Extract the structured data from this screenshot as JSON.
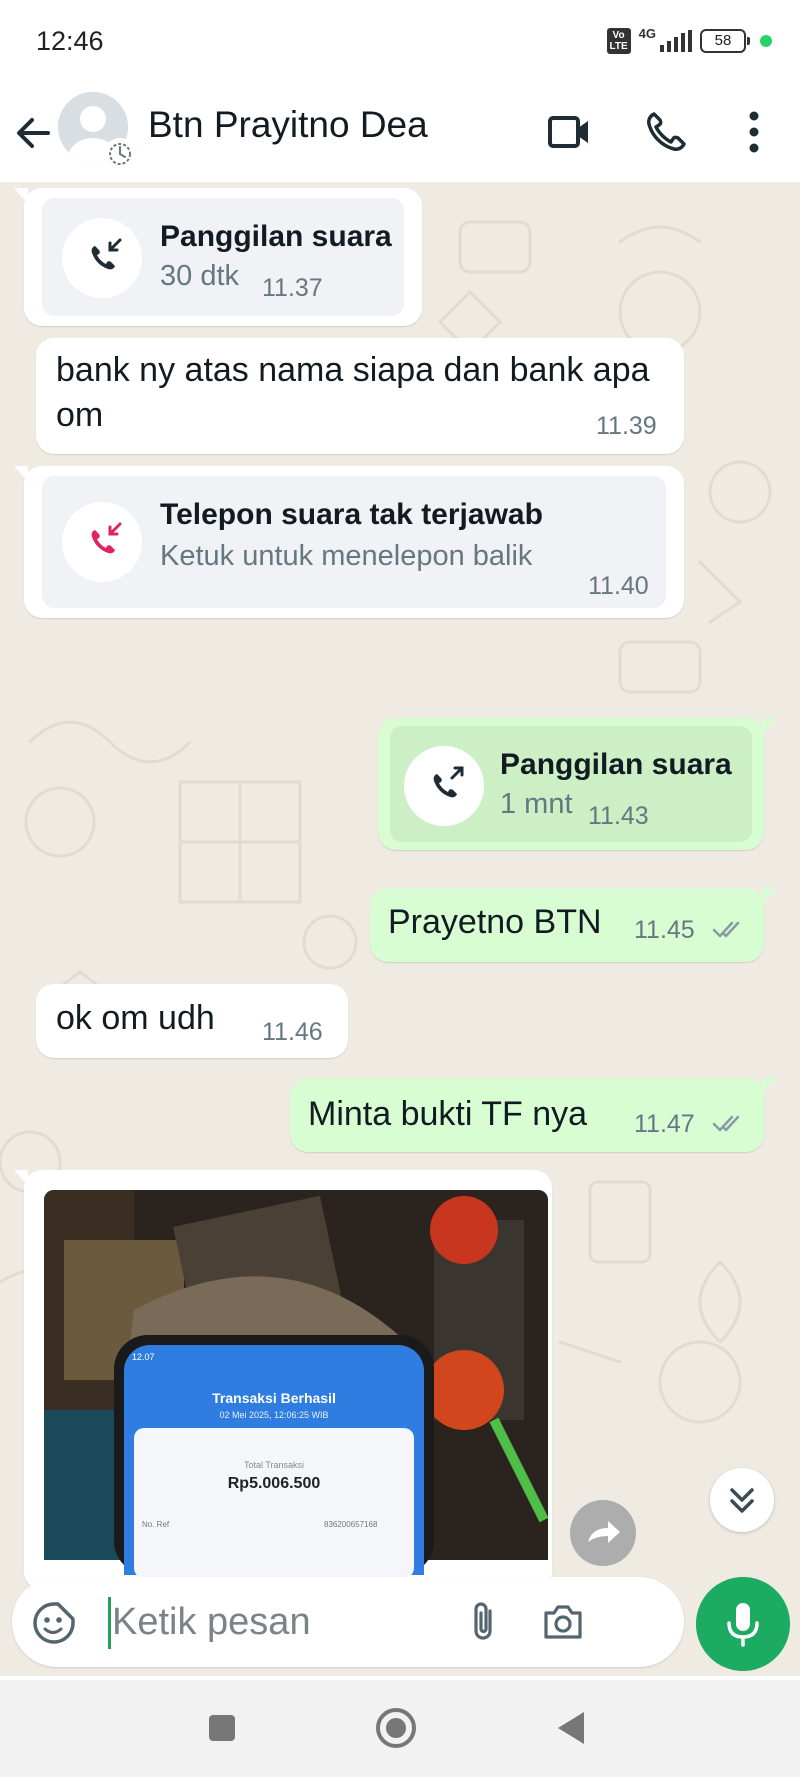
{
  "status": {
    "time": "12:46",
    "volte": "Vo LTE",
    "network": "4G",
    "battery": "58"
  },
  "header": {
    "contact_name": "Btn Prayitno Dea"
  },
  "messages": [
    {
      "kind": "call",
      "direction": "incoming",
      "title": "Panggilan suara",
      "sub": "30 dtk",
      "time": "11.37"
    },
    {
      "kind": "text",
      "direction": "incoming",
      "text": "bank ny atas nama siapa dan bank apa om",
      "time": "11.39"
    },
    {
      "kind": "missed_call",
      "direction": "incoming",
      "title": "Telepon suara tak terjawab",
      "sub": "Ketuk untuk menelepon balik",
      "time": "11.40"
    },
    {
      "kind": "call",
      "direction": "outgoing",
      "title": "Panggilan suara",
      "sub": "1 mnt",
      "time": "11.43"
    },
    {
      "kind": "text",
      "direction": "outgoing",
      "text": "Prayetno BTN",
      "time": "11.45",
      "status": "read"
    },
    {
      "kind": "text",
      "direction": "incoming",
      "text": "ok om udh",
      "time": "11.46"
    },
    {
      "kind": "text",
      "direction": "outgoing",
      "text": "Minta bukti TF nya",
      "time": "11.47",
      "status": "read"
    },
    {
      "kind": "image",
      "direction": "incoming",
      "photo": {
        "status_time": "12.07",
        "title": "Transaksi Berhasil",
        "date": "02 Mei 2025, 12:06:25 WIB",
        "total_label": "Total Transaksi",
        "amount": "Rp5.006.500",
        "ref_label": "No. Ref",
        "ref_value": "836200657168"
      }
    }
  ],
  "composer": {
    "placeholder": "Ketik pesan"
  },
  "colors": {
    "incoming_bubble": "#ffffff",
    "outgoing_bubble": "#d9fdd3",
    "accent_green": "#1daa61",
    "missed_red": "#e0245e",
    "chat_background": "#efeae2"
  }
}
